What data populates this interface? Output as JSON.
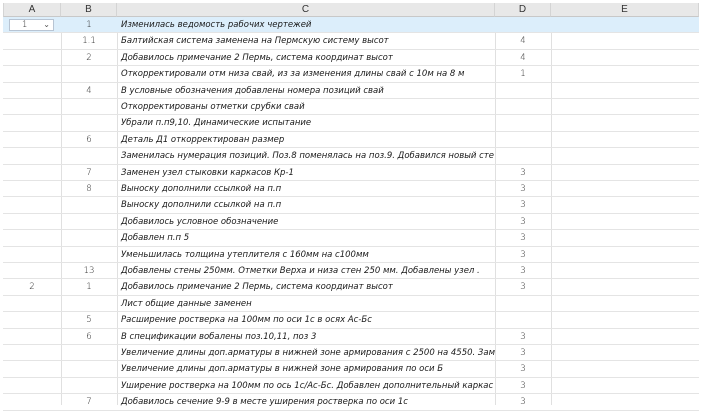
{
  "columns": [
    "A",
    "B",
    "C",
    "D",
    "E"
  ],
  "dropdown": {
    "value": "1",
    "icon": "chevron-down-icon"
  },
  "rows": [
    {
      "a": "",
      "b": "1",
      "c": "Изменилась ведомость рабочих чертежей",
      "d": ""
    },
    {
      "a": "",
      "b": "1.1",
      "c": "Балтийская система заменена на Пермскую систему высот",
      "d": "4"
    },
    {
      "a": "",
      "b": "2",
      "c": "Добавилось    примечание 2 Пермь, система координат высот",
      "d": "4"
    },
    {
      "a": "",
      "b": "",
      "c": "Откорректировали отм низа свай, из за изменения длины свай с 10м на 8 м",
      "d": "1"
    },
    {
      "a": "",
      "b": "4",
      "c": "В условные обозначения добавлены номера позиций свай",
      "d": ""
    },
    {
      "a": "",
      "b": "",
      "c": "Откорректированы отметки срубки свай",
      "d": ""
    },
    {
      "a": "",
      "b": "",
      "c": "Убрали п.п9,10.  Динамические испытание",
      "d": ""
    },
    {
      "a": "",
      "b": "6",
      "c": "Деталь Д1 откорректирован размер",
      "d": ""
    },
    {
      "a": "",
      "b": "",
      "c": "Заменилась нумерация позиций. Поз.8 поменялась на поз.9. Добавился новый сте",
      "d": ""
    },
    {
      "a": "",
      "b": "7",
      "c": "Заменен узел стыковки каркасов Кр-1",
      "d": "3"
    },
    {
      "a": "",
      "b": "8",
      "c": "Выноску дополнили ссылкой на п.п",
      "d": "3"
    },
    {
      "a": "",
      "b": "",
      "c": "Выноску дополнили ссылкой на п.п",
      "d": "3"
    },
    {
      "a": "",
      "b": "",
      "c": "Добавилось условное обозначение",
      "d": "3"
    },
    {
      "a": "",
      "b": "",
      "c": "Добавлен п.п 5",
      "d": "3"
    },
    {
      "a": "",
      "b": "",
      "c": "Уменьшилась толщина утеплителя с 160мм на с100мм",
      "d": "3"
    },
    {
      "a": "",
      "b": "13",
      "c": "Добавлены стены 250мм. Отметки Верха и низа стен 250 мм.  Добавлены узел .",
      "d": "3"
    },
    {
      "a": "2",
      "b": "1",
      "c": "Добавилось    примечание 2 Пермь, система координат высот",
      "d": "3"
    },
    {
      "a": "",
      "b": "",
      "c": "Лист общие данные заменен",
      "d": ""
    },
    {
      "a": "",
      "b": "5",
      "c": "Расширение ростверка на 100мм по оси 1с в осях Ас-Бс",
      "d": ""
    },
    {
      "a": "",
      "b": "6",
      "c": "В спецификации вобалены поз.10,11, поз 3",
      "d": "3"
    },
    {
      "a": "",
      "b": "",
      "c": "Увеличение длины доп.арматуры в нижней зоне армирования с 2500 на 4550. Зам",
      "d": "3"
    },
    {
      "a": "",
      "b": "",
      "c": "Увеличение длины доп.арматуры в нижней зоне армирования по оси Б",
      "d": "3"
    },
    {
      "a": "",
      "b": "",
      "c": "Уширение ростверка на 100мм по ось 1с/Ас-Бс. Добавлен дополнительный каркас",
      "d": "3"
    },
    {
      "a": "",
      "b": "7",
      "c": "Добавилось сечение 9-9 в месте уширения ростверка по оси 1с",
      "d": "3"
    }
  ]
}
